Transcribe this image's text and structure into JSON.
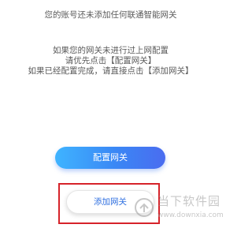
{
  "message": {
    "notice": "您的账号还未添加任何联通智能网关",
    "hint_line1": "如果您的网关未进行过上网配置",
    "hint_line2": "请优先点击【配置网关】",
    "hint_line3": "如果已经配置完成，请直接点击【添加网关】"
  },
  "actions": {
    "configure_label": "配置网关",
    "add_label": "添加网关"
  },
  "watermark": {
    "text": "当下软件园",
    "url": "www.downxia.com"
  },
  "colors": {
    "primary_gradient_start": "#3fb4ff",
    "primary_gradient_end": "#4a6cf0",
    "highlight_border": "#d6232a",
    "add_text": "#2f6fe0"
  }
}
